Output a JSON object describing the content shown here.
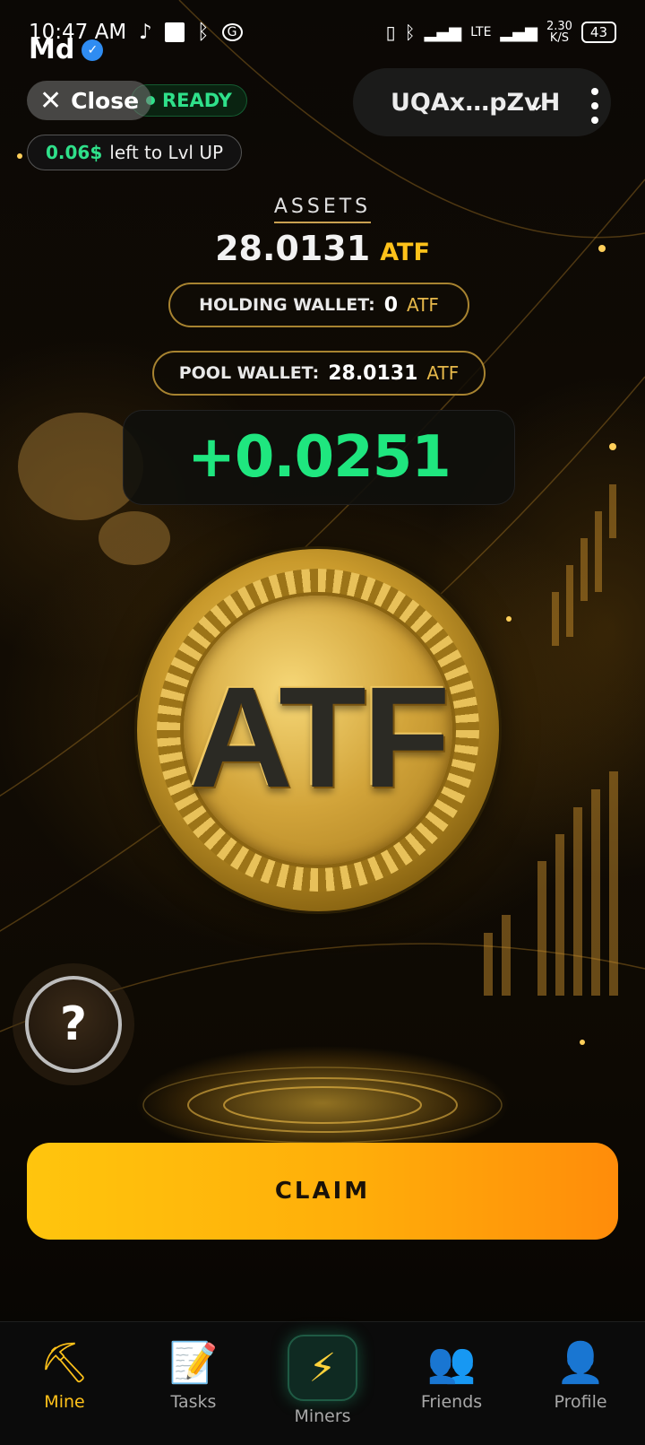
{
  "status_bar": {
    "time": "10:47 AM",
    "signal_text": "LTE",
    "net_speed": "2.30\nK/S",
    "battery": "43",
    "icons": [
      "tiktok-icon",
      "square-icon",
      "bluetooth-icon",
      "vpn-icon",
      "vibrate-icon",
      "bluetooth-icon",
      "signal-icon"
    ]
  },
  "app": {
    "md_label": "Md"
  },
  "header": {
    "close_label": "Close",
    "ready_label": "READY",
    "wallet_address": "UQAx…pZvH",
    "lvl_amount": "0.06$",
    "lvl_text": "left to Lvl UP"
  },
  "assets": {
    "title": "ASSETS",
    "value": "28.0131",
    "currency": "ATF"
  },
  "holding_wallet": {
    "label": "HOLDING WALLET:",
    "value": "0",
    "currency": "ATF"
  },
  "pool_wallet": {
    "label": "POOL WALLET:",
    "value": "28.0131",
    "currency": "ATF"
  },
  "gain": "+0.0251",
  "coin_text": "ATF",
  "help_label": "?",
  "claim_label": "CLAIM",
  "nav": [
    {
      "label": "Mine",
      "icon": "pickaxe-icon",
      "active": true
    },
    {
      "label": "Tasks",
      "icon": "memo-icon",
      "active": false
    },
    {
      "label": "Miners",
      "icon": "lightning-icon",
      "active": false
    },
    {
      "label": "Friends",
      "icon": "users-icon",
      "active": false
    },
    {
      "label": "Profile",
      "icon": "user-icon",
      "active": false
    }
  ],
  "colors": {
    "accent": "#ffc21a",
    "green": "#1fe67f",
    "claim_from": "#ffc50d",
    "claim_to": "#ff8c0a"
  }
}
